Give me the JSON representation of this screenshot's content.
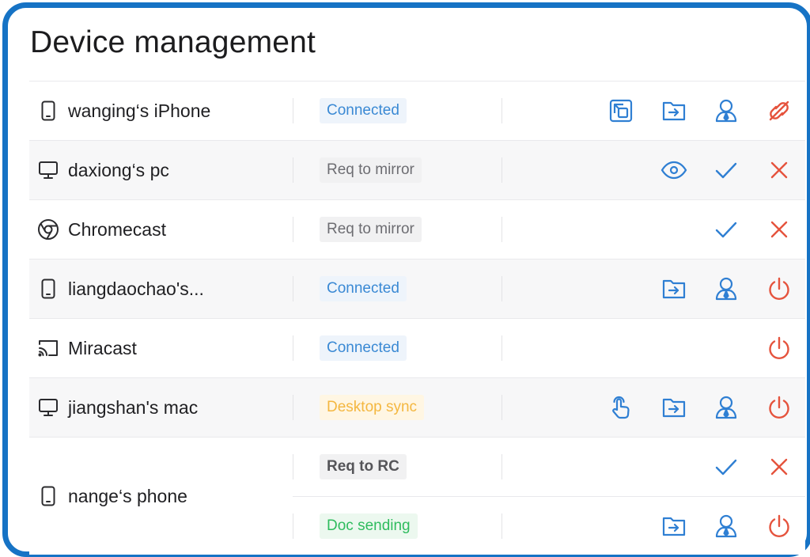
{
  "page": {
    "title": "Device management"
  },
  "colors": {
    "frame": "#1673c5",
    "action_blue": "#2f7fd3",
    "action_red": "#e5533d"
  },
  "devices": [
    {
      "name": "wanging‘s iPhone",
      "icon": "phone-icon",
      "status": "Connected",
      "status_color": "blue",
      "actions": [
        "screen-mirror-icon",
        "send-file-icon",
        "user-icon",
        "disconnect-icon"
      ]
    },
    {
      "name": "daxiong‘s pc",
      "icon": "desktop-icon",
      "status": "Req to mirror",
      "status_color": "gray",
      "actions": [
        "view-icon",
        "accept-icon",
        "reject-icon"
      ]
    },
    {
      "name": "Chromecast",
      "icon": "chrome-icon",
      "status": "Req to mirror",
      "status_color": "gray",
      "actions": [
        "accept-icon",
        "reject-icon"
      ]
    },
    {
      "name": "liangdaochao's...",
      "icon": "phone-icon",
      "status": "Connected",
      "status_color": "blue",
      "actions": [
        "send-file-icon",
        "user-icon",
        "power-icon"
      ]
    },
    {
      "name": "Miracast",
      "icon": "cast-icon",
      "status": "Connected",
      "status_color": "blue",
      "actions": [
        "power-icon"
      ]
    },
    {
      "name": "jiangshan's mac",
      "icon": "desktop-icon",
      "status": "Desktop sync",
      "status_color": "yellow",
      "actions": [
        "touch-icon",
        "send-file-icon",
        "user-icon",
        "power-icon"
      ]
    },
    {
      "name": "nange‘s phone",
      "icon": "phone-icon",
      "sessions": [
        {
          "status": "Req to RC",
          "status_color": "gray",
          "actions": [
            "accept-icon",
            "reject-icon"
          ]
        },
        {
          "status": "Doc sending",
          "status_color": "green",
          "actions": [
            "send-file-icon",
            "user-icon",
            "power-icon"
          ]
        }
      ]
    }
  ]
}
